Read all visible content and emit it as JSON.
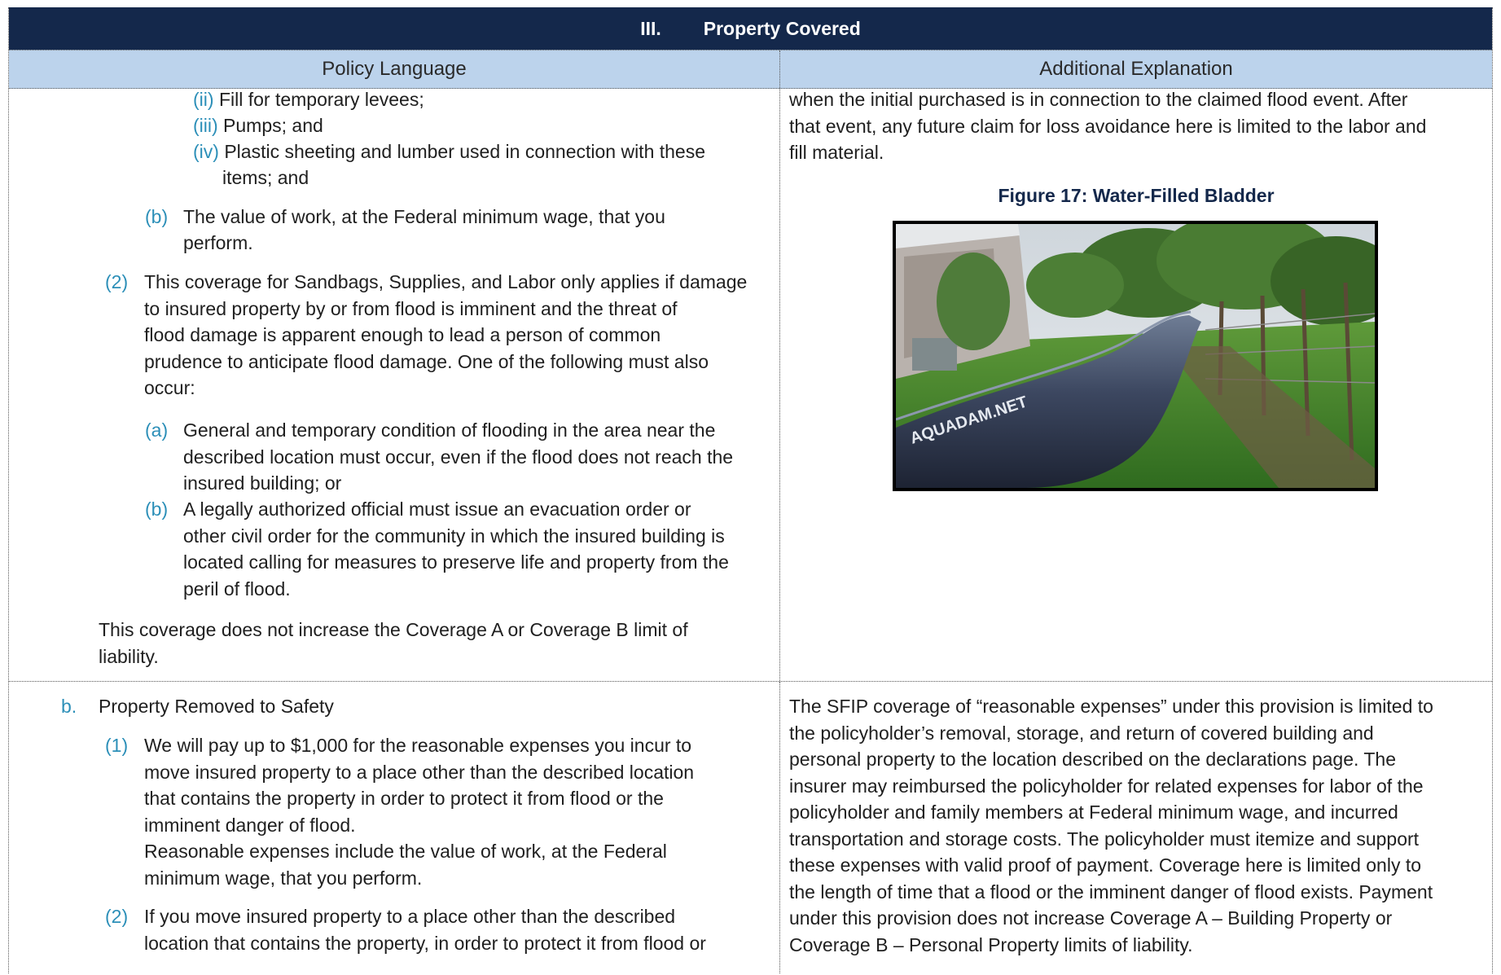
{
  "header": {
    "section_number": "III.",
    "section_title": "Property Covered"
  },
  "columns": {
    "left": "Policy Language",
    "right": "Additional Explanation"
  },
  "row1": {
    "left": {
      "ii_label": "(ii)",
      "ii_text": "Fill for temporary levees;",
      "iii_label": "(iii)",
      "iii_text": "Pumps; and",
      "iv_label": "(iv)",
      "iv_text_1": "Plastic sheeting and lumber used in connection with these",
      "iv_text_2": "items; and",
      "b_label": "(b)",
      "b_text_1": "The value of work, at the Federal minimum wage, that you",
      "b_text_2": "perform.",
      "p2_label": "(2)",
      "p2_lines": [
        "This coverage for Sandbags, Supplies, and Labor only applies if damage",
        "to insured property by or from flood is imminent and the threat of",
        "flood damage is apparent enough to lead a person of common",
        "prudence to anticipate flood damage. One of the following must also",
        "occur:"
      ],
      "a2_label": "(a)",
      "a2_lines": [
        "General and temporary condition of flooding in the area near the",
        "described location must occur, even if the flood does not reach the",
        "insured building; or"
      ],
      "b2_label": "(b)",
      "b2_lines": [
        "A legally authorized official must issue an evacuation order or",
        "other civil order for the community in which the insured building is",
        "located calling for measures to preserve life and property from the",
        "peril of flood."
      ],
      "closing_lines": [
        "This coverage does not increase the Coverage A or Coverage B limit of",
        "liability."
      ]
    },
    "right": {
      "lines": [
        "when the initial purchased is in connection to the claimed flood event. After",
        "that event, any future claim for loss avoidance here is limited to the labor and",
        "fill material."
      ],
      "figure_title": "Figure 17: Water-Filled Bladder",
      "photo_text": "AQUADAM.NET"
    }
  },
  "row2": {
    "left": {
      "b_label": "b.",
      "b_text": "Property Removed to Safety",
      "p1_label": "(1)",
      "p1_lines": [
        "We will pay up to $1,000 for the reasonable expenses you incur to",
        "move insured property to a place other than the described location",
        "that contains the property in order to protect it from flood or the",
        "imminent danger of flood."
      ],
      "reasonable_lines": [
        "Reasonable expenses include the value of work, at the Federal",
        "minimum wage, that you perform."
      ],
      "p2_label": "(2)",
      "p2_lines": [
        "If you move insured property to a place other than the described",
        "location that contains the property, in order to protect it from flood or"
      ]
    },
    "right": {
      "lines": [
        "The SFIP coverage of “reasonable expenses” under this provision is limited to",
        "the policyholder’s removal, storage, and return of covered building and",
        "personal property to the location described on the declarations page. The",
        "insurer may reimbursed the policyholder for related expenses for labor of the",
        "policyholder and family members at Federal minimum wage, and incurred",
        "transportation and storage costs. The policyholder must itemize and support",
        "these expenses with valid proof of payment. Coverage here is limited only to",
        "the length of time that a flood or the imminent danger of flood exists. Payment",
        "under this provision does not increase Coverage A – Building Property or",
        "Coverage B – Personal Property limits of liability."
      ]
    }
  }
}
